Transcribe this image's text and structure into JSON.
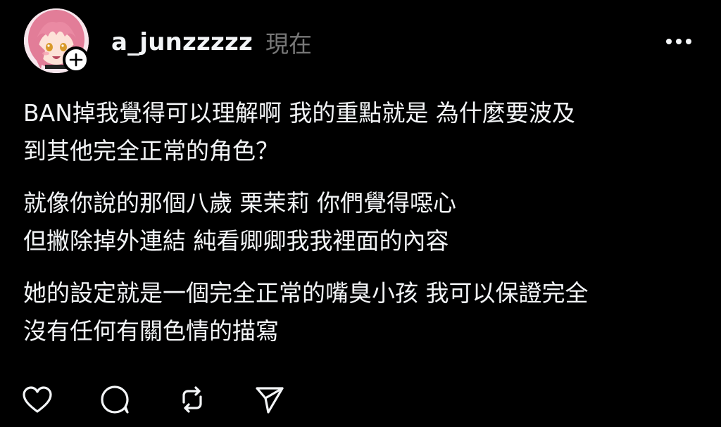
{
  "post": {
    "username": "a_junzzzzz",
    "timestamp": "現在",
    "paragraphs": [
      {
        "lines": [
          "BAN掉我覺得可以理解啊 我的重點就是 為什麼要波及",
          "到其他完全正常的角色？"
        ]
      },
      {
        "lines": [
          "就像你說的那個八歲 栗茉莉 你們覺得噁心",
          "但撇除掉外連結 純看卿卿我我裡面的內容"
        ]
      },
      {
        "lines": [
          "她的設定就是一個完全正常的嘴臭小孩 我可以保證完全",
          "沒有任何有關色情的描寫"
        ]
      }
    ]
  },
  "icons": {
    "more": "more-horizontal-icon",
    "follow": "plus-icon",
    "like": "heart-icon",
    "comment": "comment-bubble-icon",
    "repost": "repost-icon",
    "share": "send-icon"
  },
  "colors": {
    "background": "#000000",
    "text": "#f3f5f7",
    "muted": "#777777",
    "avatar_hair": "#e8879f"
  }
}
